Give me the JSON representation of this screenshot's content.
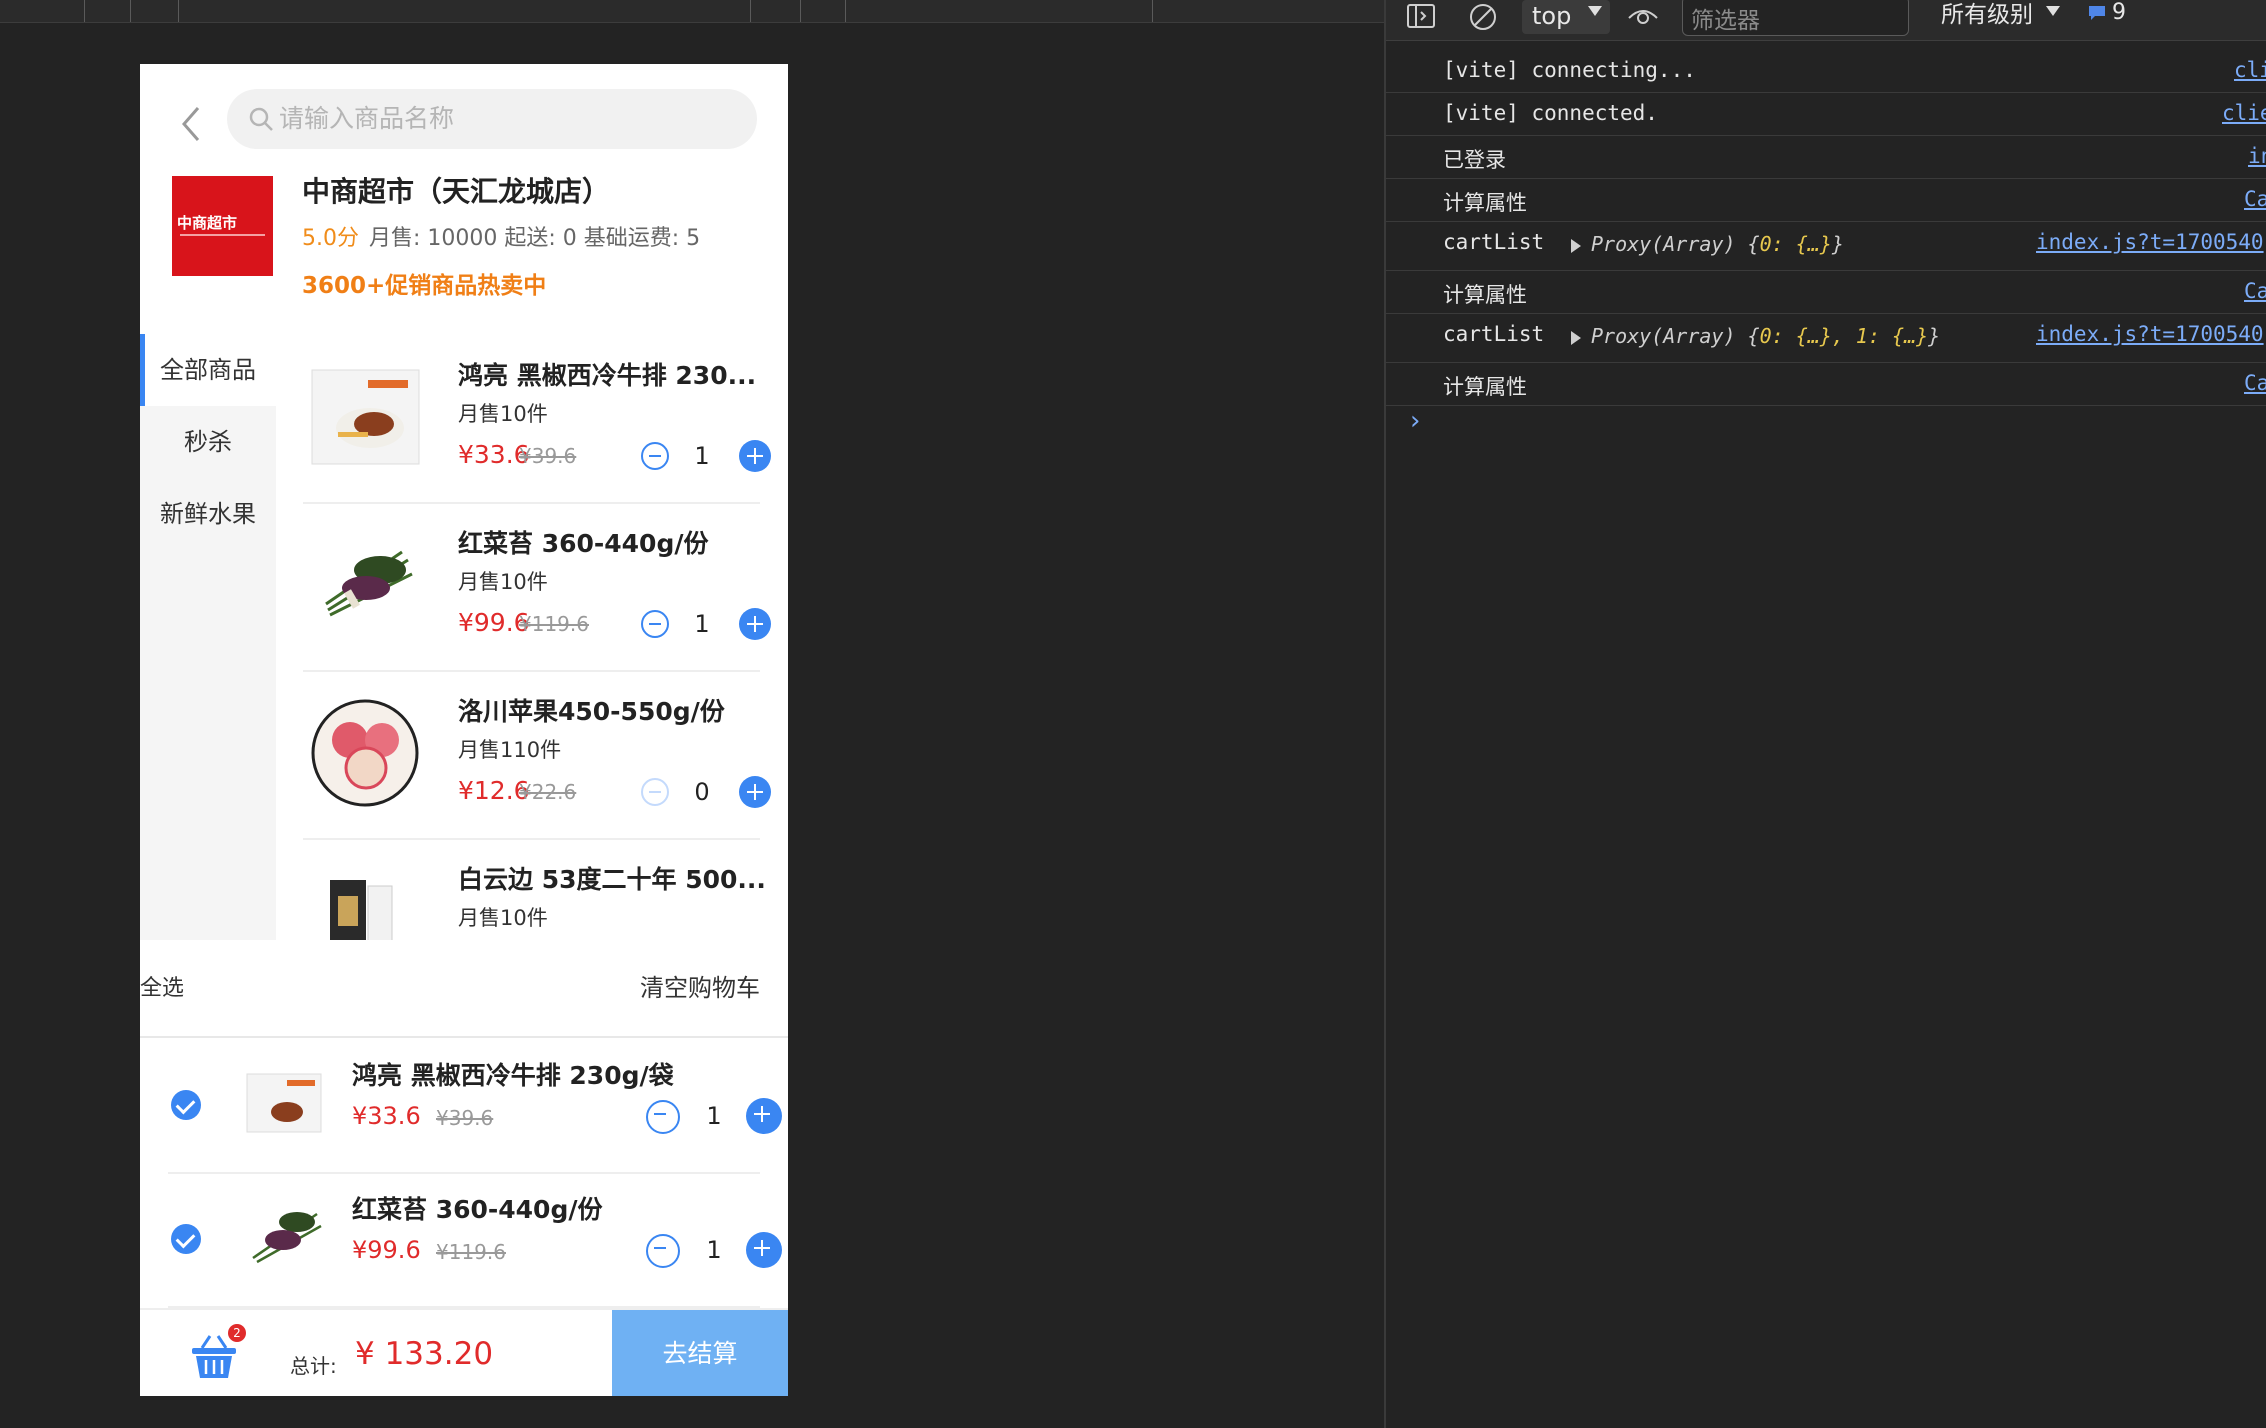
{
  "phone": {
    "search": {
      "placeholder": "请输入商品名称"
    },
    "store": {
      "logo_text": "中商超市",
      "name": "中商超市（天汇龙城店）",
      "score": "5.0分",
      "meta": "月售: 10000  起送: 0  基础运费: 5",
      "promo": "3600+促销商品热卖中"
    },
    "categories": [
      {
        "label": "全部商品",
        "active": true
      },
      {
        "label": "秒杀",
        "active": false
      },
      {
        "label": "新鲜水果",
        "active": false
      }
    ],
    "goods": [
      {
        "name": "鸿亮 黑椒西冷牛排 230...",
        "sold": "月售10件",
        "price": "¥33.6",
        "orig": "¥39.6",
        "qty": "1",
        "minus_disabled": false,
        "image": "steak-package"
      },
      {
        "name": "红菜苔 360-440g/份",
        "sold": "月售10件",
        "price": "¥99.6",
        "orig": "¥119.6",
        "qty": "1",
        "minus_disabled": false,
        "image": "vegetable-bundle"
      },
      {
        "name": "洛川苹果450-550g/份",
        "sold": "月售110件",
        "price": "¥12.6",
        "orig": "¥22.6",
        "qty": "0",
        "minus_disabled": true,
        "image": "apples-plate"
      },
      {
        "name": "白云边 53度二十年 500...",
        "sold": "月售10件",
        "price": "",
        "orig": "",
        "qty": "",
        "minus_disabled": false,
        "image": "liquor-bottle"
      }
    ],
    "cart": {
      "select_all": "全选",
      "clear": "清空购物车",
      "items": [
        {
          "name": "鸿亮 黑椒西冷牛排 230g/袋",
          "price": "¥33.6",
          "orig": "¥39.6",
          "qty": "1",
          "checked": true
        },
        {
          "name": "红菜苔 360-440g/份",
          "price": "¥99.6",
          "orig": "¥119.6",
          "qty": "1",
          "checked": true
        }
      ]
    },
    "footer": {
      "badge": "2",
      "total_label": "总计:",
      "total_value": "¥ 133.20",
      "checkout": "去结算"
    }
  },
  "devtools": {
    "context": "top",
    "filter_placeholder": "筛选器",
    "levels": "所有级别",
    "message_count": "9",
    "logs": [
      {
        "text": "[vite] connecting...",
        "source": "cli"
      },
      {
        "text": "[vite] connected.",
        "source": "clie"
      },
      {
        "text": "已登录",
        "source": "in"
      },
      {
        "text": "计算属性",
        "source": "Ca"
      },
      {
        "text": "cartList",
        "object_prefix": "Proxy(Array) {",
        "object_body": "0: {…}",
        "object_suffix": "}",
        "source": "index.js?t=1700540"
      },
      {
        "text": "计算属性",
        "source": "Ca"
      },
      {
        "text": "cartList",
        "object_prefix": "Proxy(Array) {",
        "object_body": "0: {…}, 1: {…}",
        "object_suffix": "}",
        "source": "index.js?t=1700540"
      },
      {
        "text": "计算属性",
        "source": "Ca"
      }
    ],
    "prompt": "›"
  },
  "colors": {
    "accent": "#3a86f2",
    "price": "#e02b2b",
    "promo": "#f07f16",
    "checkout": "#6fb1f3",
    "devtools_bg": "#232323",
    "link": "#7cacf8"
  }
}
